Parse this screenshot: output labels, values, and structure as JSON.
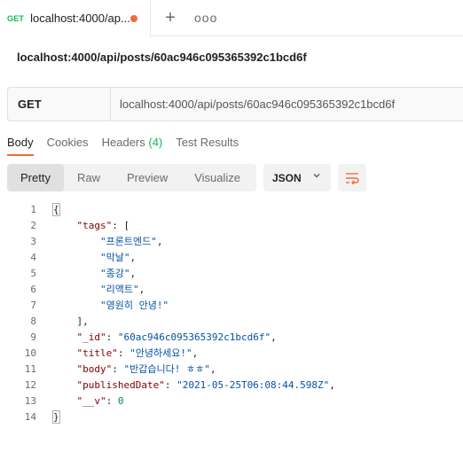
{
  "tab": {
    "method": "GET",
    "title": "localhost:4000/ap...",
    "unsaved_color": "#f26b3a"
  },
  "tabbar": {
    "add_icon": "plus-icon",
    "more_icon": "more-horizontal-icon",
    "add_label": "+",
    "more_label": "ooo"
  },
  "request": {
    "name": "localhost:4000/api/posts/60ac946c095365392c1bcd6f",
    "method": "GET",
    "url": "localhost:4000/api/posts/60ac946c095365392c1bcd6f"
  },
  "response_tabs": [
    {
      "label": "Body"
    },
    {
      "label": "Cookies"
    },
    {
      "label": "Headers",
      "count": "(4)"
    },
    {
      "label": "Test Results"
    }
  ],
  "view_modes": [
    "Pretty",
    "Raw",
    "Preview",
    "Visualize"
  ],
  "language": "JSON",
  "wrap_icon": "wrap-lines-icon",
  "colors": {
    "accent": "#f26b3a",
    "success": "#0cbb52",
    "key": "#800000",
    "string": "#0451a5",
    "number": "#098658"
  },
  "code_lines": [
    {
      "n": "1",
      "parts": [
        [
          "pun",
          "{"
        ]
      ]
    },
    {
      "n": "2",
      "parts": [
        [
          "pun",
          "    "
        ],
        [
          "key",
          "\"tags\""
        ],
        [
          "pun",
          ": ["
        ]
      ]
    },
    {
      "n": "3",
      "parts": [
        [
          "pun",
          "        "
        ],
        [
          "str",
          "\"프론트엔드\""
        ],
        [
          "pun",
          ","
        ]
      ]
    },
    {
      "n": "4",
      "parts": [
        [
          "pun",
          "        "
        ],
        [
          "str",
          "\"막날\""
        ],
        [
          "pun",
          ","
        ]
      ]
    },
    {
      "n": "5",
      "parts": [
        [
          "pun",
          "        "
        ],
        [
          "str",
          "\"종강\""
        ],
        [
          "pun",
          ","
        ]
      ]
    },
    {
      "n": "6",
      "parts": [
        [
          "pun",
          "        "
        ],
        [
          "str",
          "\"리액트\""
        ],
        [
          "pun",
          ","
        ]
      ]
    },
    {
      "n": "7",
      "parts": [
        [
          "pun",
          "        "
        ],
        [
          "str",
          "\"영원히 안녕!\""
        ]
      ]
    },
    {
      "n": "8",
      "parts": [
        [
          "pun",
          "    ],"
        ]
      ]
    },
    {
      "n": "9",
      "parts": [
        [
          "pun",
          "    "
        ],
        [
          "key",
          "\"_id\""
        ],
        [
          "pun",
          ": "
        ],
        [
          "str",
          "\"60ac946c095365392c1bcd6f\""
        ],
        [
          "pun",
          ","
        ]
      ]
    },
    {
      "n": "10",
      "parts": [
        [
          "pun",
          "    "
        ],
        [
          "key",
          "\"title\""
        ],
        [
          "pun",
          ": "
        ],
        [
          "str",
          "\"안녕하세요!\""
        ],
        [
          "pun",
          ","
        ]
      ]
    },
    {
      "n": "11",
      "parts": [
        [
          "pun",
          "    "
        ],
        [
          "key",
          "\"body\""
        ],
        [
          "pun",
          ": "
        ],
        [
          "str",
          "\"반갑습니다! ㅎㅎ\""
        ],
        [
          "pun",
          ","
        ]
      ]
    },
    {
      "n": "12",
      "parts": [
        [
          "pun",
          "    "
        ],
        [
          "key",
          "\"publishedDate\""
        ],
        [
          "pun",
          ": "
        ],
        [
          "str",
          "\"2021-05-25T06:08:44.598Z\""
        ],
        [
          "pun",
          ","
        ]
      ]
    },
    {
      "n": "13",
      "parts": [
        [
          "pun",
          "    "
        ],
        [
          "key",
          "\"__v\""
        ],
        [
          "pun",
          ": "
        ],
        [
          "num",
          "0"
        ]
      ]
    },
    {
      "n": "14",
      "parts": [
        [
          "pun",
          "}"
        ]
      ]
    }
  ]
}
